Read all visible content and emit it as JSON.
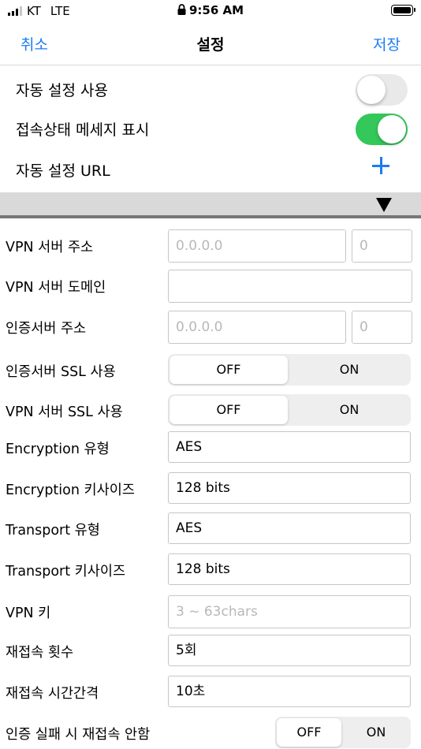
{
  "status": {
    "carrier": "KT",
    "network": "LTE",
    "time": "9:56 AM"
  },
  "nav": {
    "cancel_label": "취소",
    "title": "설정",
    "save_label": "저장"
  },
  "settings": {
    "auto_config_label": "자동 설정 사용",
    "auto_config_on": false,
    "show_status_label": "접속상태 메세지 표시",
    "show_status_on": true,
    "auto_config_url_label": "자동 설정 URL"
  },
  "form": {
    "vpn_server_address_label": "VPN 서버 주소",
    "vpn_server_address_placeholder": "0.0.0.0",
    "vpn_server_port_placeholder": "0",
    "vpn_server_domain_label": "VPN 서버 도메인",
    "vpn_server_domain_value": "",
    "auth_server_address_label": "인증서버 주소",
    "auth_server_address_placeholder": "0.0.0.0",
    "auth_server_port_placeholder": "0",
    "auth_ssl_label": "인증서버 SSL 사용",
    "vpn_ssl_label": "VPN 서버 SSL 사용",
    "off_label": "OFF",
    "on_label": "ON",
    "encryption_type_label": "Encryption 유형",
    "encryption_type_value": "AES",
    "encryption_keysize_label": "Encryption 키사이즈",
    "encryption_keysize_value": "128 bits",
    "transport_type_label": "Transport 유형",
    "transport_type_value": "AES",
    "transport_keysize_label": "Transport 키사이즈",
    "transport_keysize_value": "128 bits",
    "vpn_key_label": "VPN 키",
    "vpn_key_placeholder": "3 ~ 63chars",
    "reconnect_count_label": "재접속 횟수",
    "reconnect_count_value": "5회",
    "reconnect_interval_label": "재접속 시간간격",
    "reconnect_interval_value": "10초",
    "no_reconnect_on_auth_fail_label": "인증 실패 시 재접속 안함"
  },
  "colors": {
    "accent": "#1a7cf5",
    "toggle_on": "#34c759",
    "toggle_off": "#e9e9ea"
  }
}
